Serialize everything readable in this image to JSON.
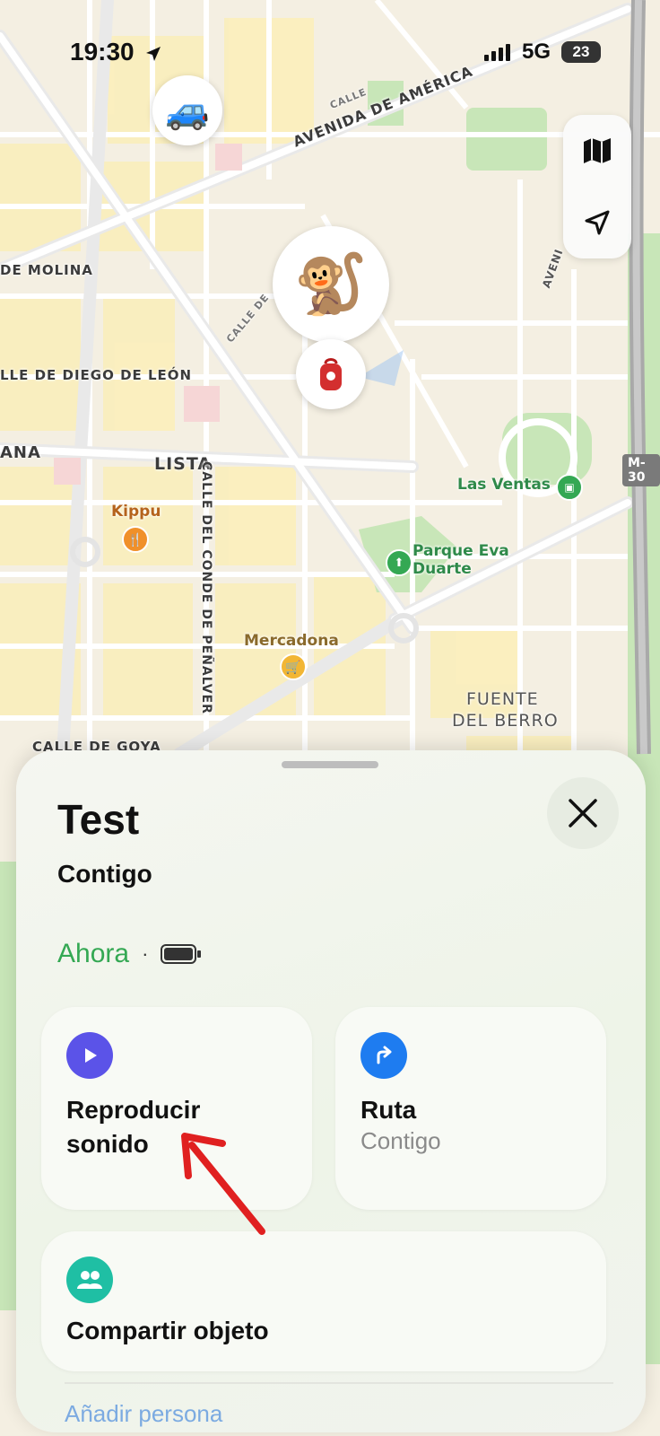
{
  "status_bar": {
    "time": "19:30",
    "network": "5G",
    "battery": "23"
  },
  "map": {
    "streets": [
      "AVENIDA DE AMÉRICA",
      "DE MOLINA",
      "LLE DE DIEGO DE LEÓN",
      "ANA",
      "LISTA",
      "CALLE DEL CONDE DE PEÑALVER",
      "CALLE DE GOYA",
      "CALLE",
      "CALLE DE",
      "AVENI",
      "M-30"
    ],
    "districts": {
      "fuente_line1": "FUENTE",
      "fuente_line2": "DEL BERRO"
    },
    "pois": {
      "kippu": "Kippu",
      "mercadona": "Mercadona",
      "las_ventas": "Las Ventas",
      "parque_line1": "Parque Eva",
      "parque_line2": "Duarte"
    },
    "colors": {
      "land": "#f4efe2",
      "road": "#ffffff",
      "park": "#c8e6b8",
      "highway": "#a9a9a9",
      "block": "#fbeeb9"
    }
  },
  "markers": {
    "car": "🚙",
    "monkey": "🐒",
    "item_icon": "backpack-icon"
  },
  "sheet": {
    "title": "Test",
    "subtitle": "Contigo",
    "status": "Ahora",
    "status_separator": "·",
    "actions": {
      "play_sound": {
        "line1": "Reproducir",
        "line2": "sonido",
        "icon": "play-icon",
        "color": "#5b53e8"
      },
      "route": {
        "title": "Ruta",
        "subtitle": "Contigo",
        "icon": "turn-right-arrow-icon",
        "color": "#1e7cf0"
      },
      "share": {
        "title": "Compartir objeto",
        "icon": "people-icon",
        "color": "#1fbfa4"
      }
    },
    "peek_text": "Añadir persona"
  },
  "annotation": {
    "arrow_color": "#e02020"
  }
}
